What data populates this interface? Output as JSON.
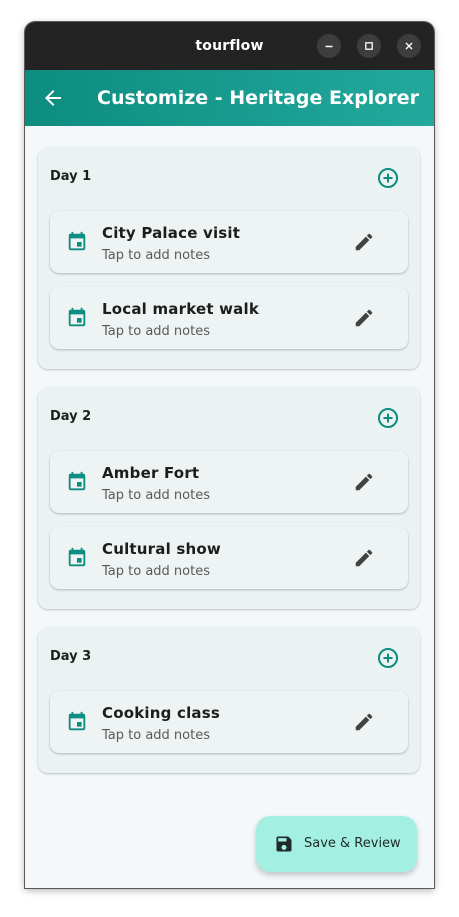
{
  "window": {
    "title": "tourflow"
  },
  "appbar": {
    "title": "Customize - Heritage Explorer",
    "back_icon": "arrow-back-icon"
  },
  "days": [
    {
      "label": "Day 1",
      "activities": [
        {
          "name": "City Palace visit",
          "notes": "Tap to add notes"
        },
        {
          "name": "Local market walk",
          "notes": "Tap to add notes"
        }
      ]
    },
    {
      "label": "Day 2",
      "activities": [
        {
          "name": "Amber Fort",
          "notes": "Tap to add notes"
        },
        {
          "name": "Cultural show",
          "notes": "Tap to add notes"
        }
      ]
    },
    {
      "label": "Day 3",
      "activities": [
        {
          "name": "Cooking class",
          "notes": "Tap to add notes"
        }
      ]
    }
  ],
  "fab": {
    "label": "Save & Review",
    "icon": "save-icon"
  },
  "colors": {
    "accent": "#0d8c80",
    "titlebar": "#232323",
    "fab": "#a3f0e3",
    "card": "#ebf2f2",
    "background": "#f4f8fb"
  }
}
